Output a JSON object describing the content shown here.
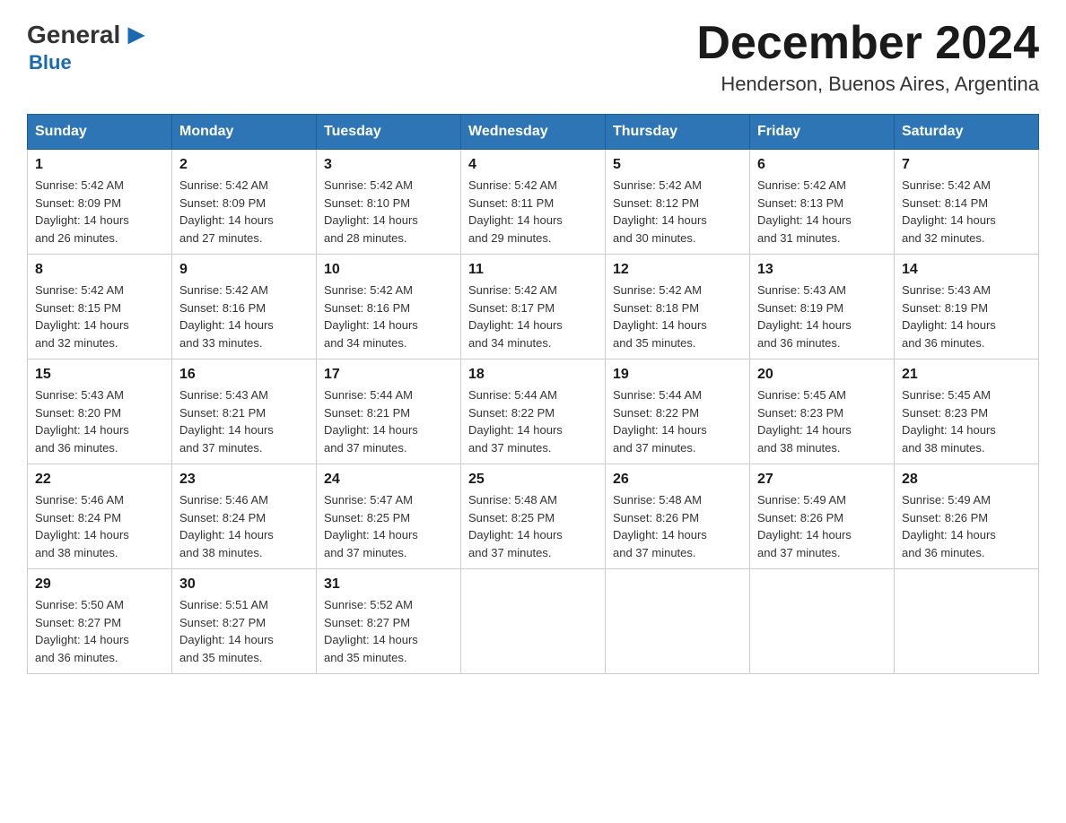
{
  "header": {
    "logo_general": "General",
    "logo_blue": "Blue",
    "main_title": "December 2024",
    "subtitle": "Henderson, Buenos Aires, Argentina"
  },
  "calendar": {
    "days_of_week": [
      "Sunday",
      "Monday",
      "Tuesday",
      "Wednesday",
      "Thursday",
      "Friday",
      "Saturday"
    ],
    "weeks": [
      [
        {
          "day": "1",
          "sunrise": "5:42 AM",
          "sunset": "8:09 PM",
          "daylight": "14 hours and 26 minutes."
        },
        {
          "day": "2",
          "sunrise": "5:42 AM",
          "sunset": "8:09 PM",
          "daylight": "14 hours and 27 minutes."
        },
        {
          "day": "3",
          "sunrise": "5:42 AM",
          "sunset": "8:10 PM",
          "daylight": "14 hours and 28 minutes."
        },
        {
          "day": "4",
          "sunrise": "5:42 AM",
          "sunset": "8:11 PM",
          "daylight": "14 hours and 29 minutes."
        },
        {
          "day": "5",
          "sunrise": "5:42 AM",
          "sunset": "8:12 PM",
          "daylight": "14 hours and 30 minutes."
        },
        {
          "day": "6",
          "sunrise": "5:42 AM",
          "sunset": "8:13 PM",
          "daylight": "14 hours and 31 minutes."
        },
        {
          "day": "7",
          "sunrise": "5:42 AM",
          "sunset": "8:14 PM",
          "daylight": "14 hours and 32 minutes."
        }
      ],
      [
        {
          "day": "8",
          "sunrise": "5:42 AM",
          "sunset": "8:15 PM",
          "daylight": "14 hours and 32 minutes."
        },
        {
          "day": "9",
          "sunrise": "5:42 AM",
          "sunset": "8:16 PM",
          "daylight": "14 hours and 33 minutes."
        },
        {
          "day": "10",
          "sunrise": "5:42 AM",
          "sunset": "8:16 PM",
          "daylight": "14 hours and 34 minutes."
        },
        {
          "day": "11",
          "sunrise": "5:42 AM",
          "sunset": "8:17 PM",
          "daylight": "14 hours and 34 minutes."
        },
        {
          "day": "12",
          "sunrise": "5:42 AM",
          "sunset": "8:18 PM",
          "daylight": "14 hours and 35 minutes."
        },
        {
          "day": "13",
          "sunrise": "5:43 AM",
          "sunset": "8:19 PM",
          "daylight": "14 hours and 36 minutes."
        },
        {
          "day": "14",
          "sunrise": "5:43 AM",
          "sunset": "8:19 PM",
          "daylight": "14 hours and 36 minutes."
        }
      ],
      [
        {
          "day": "15",
          "sunrise": "5:43 AM",
          "sunset": "8:20 PM",
          "daylight": "14 hours and 36 minutes."
        },
        {
          "day": "16",
          "sunrise": "5:43 AM",
          "sunset": "8:21 PM",
          "daylight": "14 hours and 37 minutes."
        },
        {
          "day": "17",
          "sunrise": "5:44 AM",
          "sunset": "8:21 PM",
          "daylight": "14 hours and 37 minutes."
        },
        {
          "day": "18",
          "sunrise": "5:44 AM",
          "sunset": "8:22 PM",
          "daylight": "14 hours and 37 minutes."
        },
        {
          "day": "19",
          "sunrise": "5:44 AM",
          "sunset": "8:22 PM",
          "daylight": "14 hours and 37 minutes."
        },
        {
          "day": "20",
          "sunrise": "5:45 AM",
          "sunset": "8:23 PM",
          "daylight": "14 hours and 38 minutes."
        },
        {
          "day": "21",
          "sunrise": "5:45 AM",
          "sunset": "8:23 PM",
          "daylight": "14 hours and 38 minutes."
        }
      ],
      [
        {
          "day": "22",
          "sunrise": "5:46 AM",
          "sunset": "8:24 PM",
          "daylight": "14 hours and 38 minutes."
        },
        {
          "day": "23",
          "sunrise": "5:46 AM",
          "sunset": "8:24 PM",
          "daylight": "14 hours and 38 minutes."
        },
        {
          "day": "24",
          "sunrise": "5:47 AM",
          "sunset": "8:25 PM",
          "daylight": "14 hours and 37 minutes."
        },
        {
          "day": "25",
          "sunrise": "5:48 AM",
          "sunset": "8:25 PM",
          "daylight": "14 hours and 37 minutes."
        },
        {
          "day": "26",
          "sunrise": "5:48 AM",
          "sunset": "8:26 PM",
          "daylight": "14 hours and 37 minutes."
        },
        {
          "day": "27",
          "sunrise": "5:49 AM",
          "sunset": "8:26 PM",
          "daylight": "14 hours and 37 minutes."
        },
        {
          "day": "28",
          "sunrise": "5:49 AM",
          "sunset": "8:26 PM",
          "daylight": "14 hours and 36 minutes."
        }
      ],
      [
        {
          "day": "29",
          "sunrise": "5:50 AM",
          "sunset": "8:27 PM",
          "daylight": "14 hours and 36 minutes."
        },
        {
          "day": "30",
          "sunrise": "5:51 AM",
          "sunset": "8:27 PM",
          "daylight": "14 hours and 35 minutes."
        },
        {
          "day": "31",
          "sunrise": "5:52 AM",
          "sunset": "8:27 PM",
          "daylight": "14 hours and 35 minutes."
        },
        null,
        null,
        null,
        null
      ]
    ]
  },
  "labels": {
    "sunrise": "Sunrise:",
    "sunset": "Sunset:",
    "daylight": "Daylight:"
  }
}
